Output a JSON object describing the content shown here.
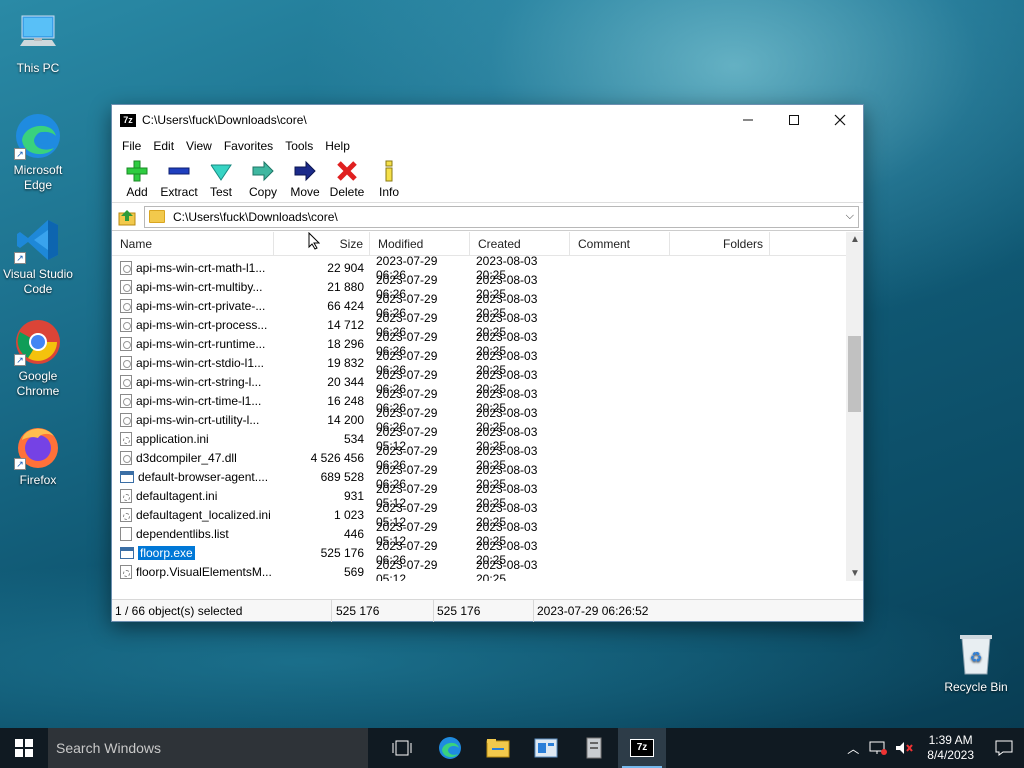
{
  "desktop": {
    "icons": [
      {
        "label": "This PC"
      },
      {
        "label": "Microsoft Edge"
      },
      {
        "label": "Visual Studio Code"
      },
      {
        "label": "Google Chrome"
      },
      {
        "label": "Firefox"
      }
    ],
    "recycle_bin": "Recycle Bin"
  },
  "window": {
    "app_badge": "7z",
    "title": "C:\\Users\\fuck\\Downloads\\core\\",
    "menu": [
      "File",
      "Edit",
      "View",
      "Favorites",
      "Tools",
      "Help"
    ],
    "toolbar": [
      "Add",
      "Extract",
      "Test",
      "Copy",
      "Move",
      "Delete",
      "Info"
    ],
    "address": "C:\\Users\\fuck\\Downloads\\core\\",
    "columns": [
      "Name",
      "Size",
      "Modified",
      "Created",
      "Comment",
      "Folders"
    ],
    "rows": [
      {
        "name": "api-ms-win-crt-math-l1...",
        "size": "22 904",
        "modified": "2023-07-29 06:26",
        "created": "2023-08-03 20:25",
        "icon": "dll"
      },
      {
        "name": "api-ms-win-crt-multiby...",
        "size": "21 880",
        "modified": "2023-07-29 06:26",
        "created": "2023-08-03 20:25",
        "icon": "dll"
      },
      {
        "name": "api-ms-win-crt-private-...",
        "size": "66 424",
        "modified": "2023-07-29 06:26",
        "created": "2023-08-03 20:25",
        "icon": "dll"
      },
      {
        "name": "api-ms-win-crt-process...",
        "size": "14 712",
        "modified": "2023-07-29 06:26",
        "created": "2023-08-03 20:25",
        "icon": "dll"
      },
      {
        "name": "api-ms-win-crt-runtime...",
        "size": "18 296",
        "modified": "2023-07-29 06:26",
        "created": "2023-08-03 20:25",
        "icon": "dll"
      },
      {
        "name": "api-ms-win-crt-stdio-l1...",
        "size": "19 832",
        "modified": "2023-07-29 06:26",
        "created": "2023-08-03 20:25",
        "icon": "dll"
      },
      {
        "name": "api-ms-win-crt-string-l...",
        "size": "20 344",
        "modified": "2023-07-29 06:26",
        "created": "2023-08-03 20:25",
        "icon": "dll"
      },
      {
        "name": "api-ms-win-crt-time-l1...",
        "size": "16 248",
        "modified": "2023-07-29 06:26",
        "created": "2023-08-03 20:25",
        "icon": "dll"
      },
      {
        "name": "api-ms-win-crt-utility-l...",
        "size": "14 200",
        "modified": "2023-07-29 06:26",
        "created": "2023-08-03 20:25",
        "icon": "dll"
      },
      {
        "name": "application.ini",
        "size": "534",
        "modified": "2023-07-29 05:12",
        "created": "2023-08-03 20:25",
        "icon": "ini"
      },
      {
        "name": "d3dcompiler_47.dll",
        "size": "4 526 456",
        "modified": "2023-07-29 06:26",
        "created": "2023-08-03 20:25",
        "icon": "dll"
      },
      {
        "name": "default-browser-agent....",
        "size": "689 528",
        "modified": "2023-07-29 06:26",
        "created": "2023-08-03 20:25",
        "icon": "exe"
      },
      {
        "name": "defaultagent.ini",
        "size": "931",
        "modified": "2023-07-29 05:12",
        "created": "2023-08-03 20:25",
        "icon": "ini"
      },
      {
        "name": "defaultagent_localized.ini",
        "size": "1 023",
        "modified": "2023-07-29 05:12",
        "created": "2023-08-03 20:25",
        "icon": "ini"
      },
      {
        "name": "dependentlibs.list",
        "size": "446",
        "modified": "2023-07-29 05:12",
        "created": "2023-08-03 20:25",
        "icon": "txt"
      },
      {
        "name": "floorp.exe",
        "size": "525 176",
        "modified": "2023-07-29 06:26",
        "created": "2023-08-03 20:25",
        "icon": "exe",
        "selected": true
      },
      {
        "name": "floorp.VisualElementsM...",
        "size": "569",
        "modified": "2023-07-29 05:12",
        "created": "2023-08-03 20:25",
        "icon": "ini"
      }
    ],
    "status": {
      "selection": "1 / 66 object(s) selected",
      "size1": "525 176",
      "size2": "525 176",
      "datetime": "2023-07-29 06:26:52"
    }
  },
  "taskbar": {
    "search_placeholder": "Search Windows",
    "time": "1:39 AM",
    "date": "8/4/2023"
  }
}
